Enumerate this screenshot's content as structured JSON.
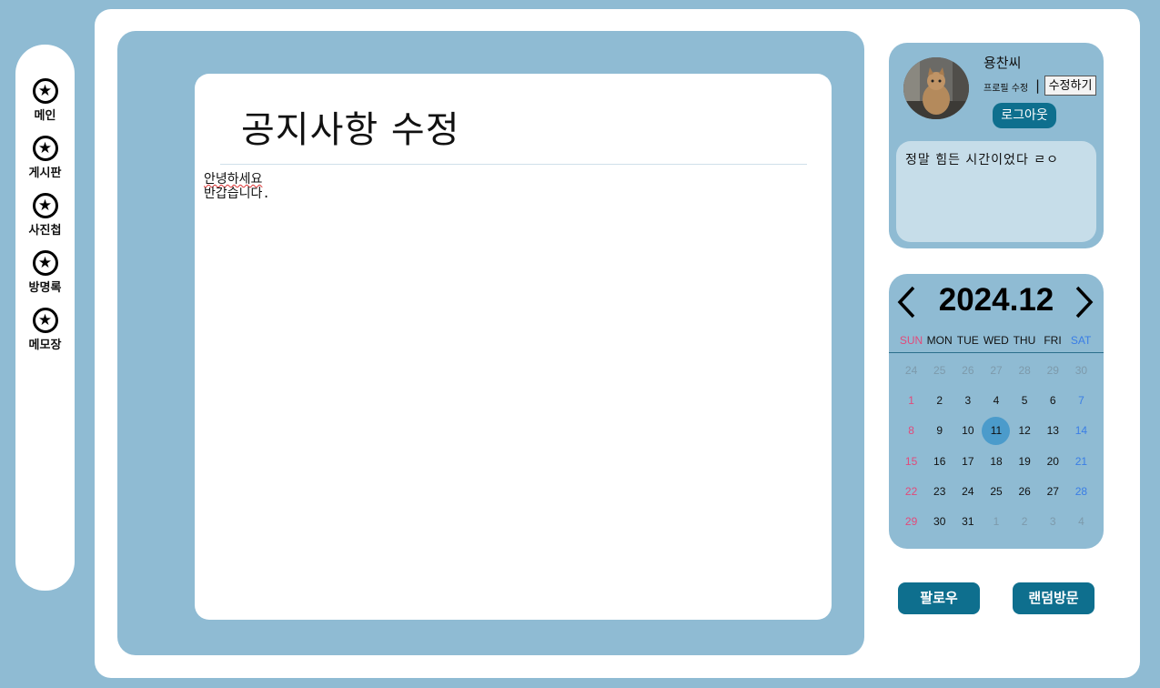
{
  "nav": {
    "items": [
      {
        "label": "메인",
        "icon": "star-icon"
      },
      {
        "label": "게시판",
        "icon": "star-icon"
      },
      {
        "label": "사진첩",
        "icon": "star-icon"
      },
      {
        "label": "방명록",
        "icon": "star-icon"
      },
      {
        "label": "메모장",
        "icon": "star-icon"
      }
    ]
  },
  "editor": {
    "title": "공지사항 수정",
    "lines": [
      "안녕하세요",
      "반갑습니다."
    ]
  },
  "profile": {
    "username": "용찬씨",
    "edit_label": "프로필 수정",
    "separator": "|",
    "edit_button": "수정하기",
    "logout_button": "로그아웃",
    "status": "정말 힘든 시간이었다 ㄹㅇ",
    "avatar": "cat-photo"
  },
  "calendar": {
    "title": "2024.12",
    "prev_icon": "chevron-left-icon",
    "next_icon": "chevron-right-icon",
    "weekdays": [
      "SUN",
      "MON",
      "TUE",
      "WED",
      "THU",
      "FRI",
      "SAT"
    ],
    "weeks": [
      [
        "24",
        "25",
        "26",
        "27",
        "28",
        "29",
        "30"
      ],
      [
        "1",
        "2",
        "3",
        "4",
        "5",
        "6",
        "7"
      ],
      [
        "8",
        "9",
        "10",
        "11",
        "12",
        "13",
        "14"
      ],
      [
        "15",
        "16",
        "17",
        "18",
        "19",
        "20",
        "21"
      ],
      [
        "22",
        "23",
        "24",
        "25",
        "26",
        "27",
        "28"
      ],
      [
        "29",
        "30",
        "31",
        "1",
        "2",
        "3",
        "4"
      ]
    ],
    "today": "11",
    "colors": {
      "sunday": "#e24a7a",
      "saturday": "#3a7ee6",
      "today": "#4b9bcb"
    }
  },
  "actions": {
    "follow": "팔로우",
    "random_visit": "랜덤방문"
  },
  "colors": {
    "background": "#8fbbd3",
    "accent": "#0e6f8e"
  }
}
